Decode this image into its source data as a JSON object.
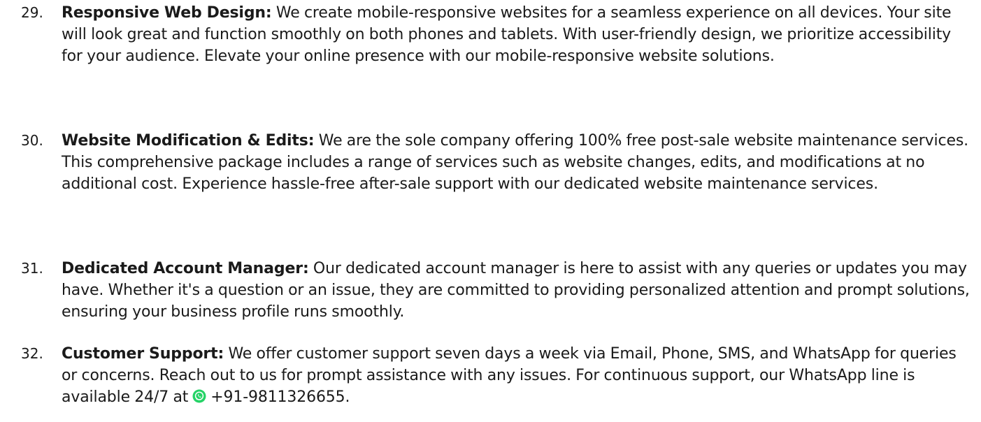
{
  "items": [
    {
      "number": "29.",
      "title": "Responsive Web Design:",
      "body": " We create mobile-responsive websites for a seamless experience on all devices. Your site will look great and function smoothly on both phones and tablets. With user-friendly design, we prioritize accessibility for your audience. Elevate your online presence with our mobile-responsive website solutions."
    },
    {
      "number": "30.",
      "title": "Website Modification & Edits:",
      "body": " We are the sole company offering 100% free post-sale website maintenance services. This comprehensive package includes a range of services such as website changes, edits, and modifications at no additional cost. Experience hassle-free after-sale support with our dedicated website maintenance services."
    },
    {
      "number": "31.",
      "title": "Dedicated Account Manager:",
      "body": " Our dedicated account manager is here to assist with any queries or updates you may have. Whether it's a question or an issue, they are committed to providing personalized attention and prompt solutions, ensuring your business profile runs smoothly."
    },
    {
      "number": "32.",
      "title": "Customer Support:",
      "body": " We offer customer support seven days a week via Email, Phone, SMS, and WhatsApp for queries or concerns. Reach out to us for prompt assistance with any issues. For continuous support, our WhatsApp line is available 24/7 at",
      "phone": "+91-9811326655",
      "end": ".",
      "icon": "whatsapp-icon"
    }
  ],
  "colors": {
    "text": "#1a1a1a",
    "whatsapp": "#25d366"
  }
}
